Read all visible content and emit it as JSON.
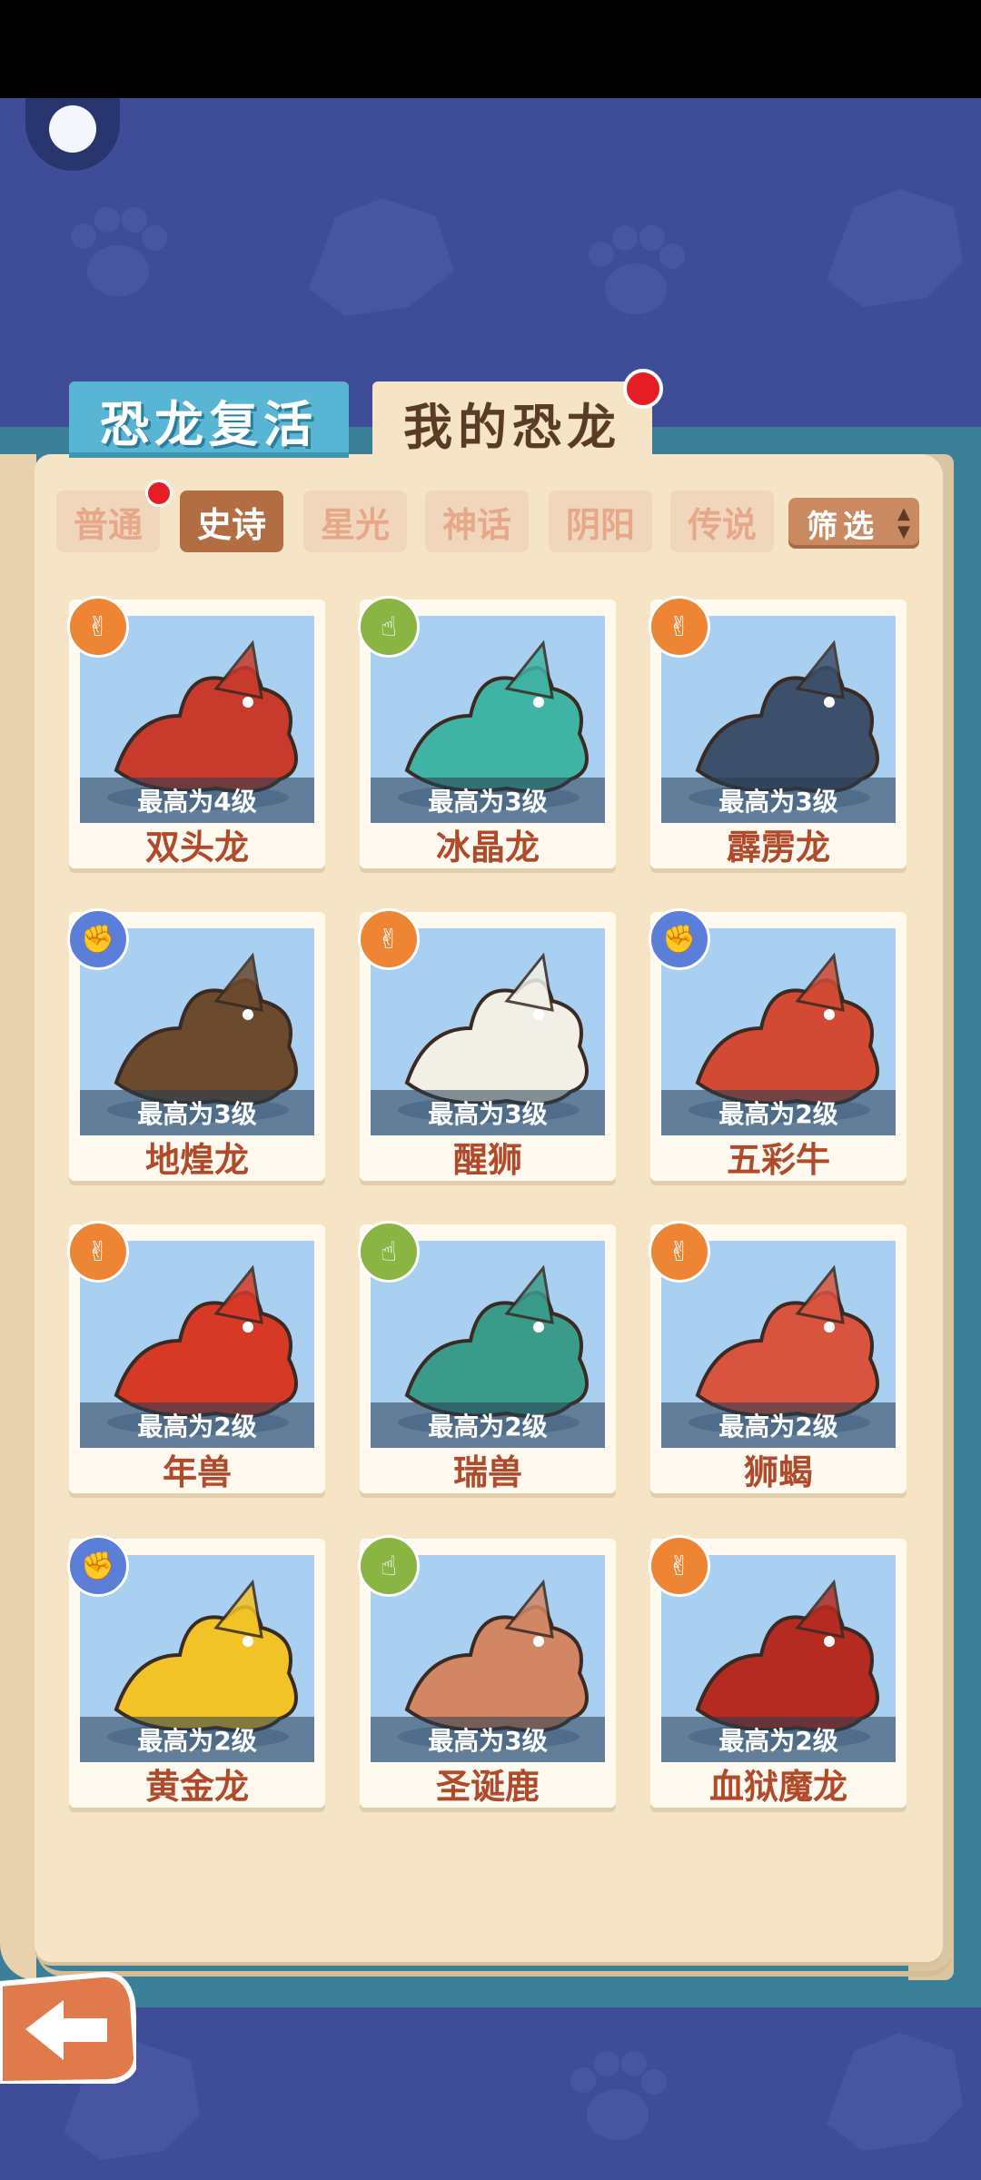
{
  "tabs": {
    "revive": "恐龙复活",
    "mine": "我的恐龙"
  },
  "rarities": [
    {
      "label": "普通",
      "active": false
    },
    {
      "label": "史诗",
      "active": true
    },
    {
      "label": "星光",
      "active": false
    },
    {
      "label": "神话",
      "active": false
    },
    {
      "label": "阴阳",
      "active": false
    },
    {
      "label": "传说",
      "active": false
    }
  ],
  "filter": {
    "label": "筛选"
  },
  "cards": [
    {
      "name": "双头龙",
      "level": "最高为4级",
      "badge": "scissors",
      "color": "#c83a2c"
    },
    {
      "name": "冰晶龙",
      "level": "最高为3级",
      "badge": "paper",
      "color": "#3fb4a4"
    },
    {
      "name": "霹雳龙",
      "level": "最高为3级",
      "badge": "scissors",
      "color": "#3c4f6b"
    },
    {
      "name": "地煌龙",
      "level": "最高为3级",
      "badge": "rock",
      "color": "#6b4a2e"
    },
    {
      "name": "醒狮",
      "level": "最高为3级",
      "badge": "scissors",
      "color": "#f2efe6"
    },
    {
      "name": "五彩牛",
      "level": "最高为2级",
      "badge": "rock",
      "color": "#d24a34"
    },
    {
      "name": "年兽",
      "level": "最高为2级",
      "badge": "scissors",
      "color": "#d63a26"
    },
    {
      "name": "瑞兽",
      "level": "最高为2级",
      "badge": "paper",
      "color": "#3a9b8a"
    },
    {
      "name": "狮蝎",
      "level": "最高为2级",
      "badge": "scissors",
      "color": "#d8543f"
    },
    {
      "name": "黄金龙",
      "level": "最高为2级",
      "badge": "rock",
      "color": "#f2c326"
    },
    {
      "name": "圣诞鹿",
      "level": "最高为3级",
      "badge": "paper",
      "color": "#d28664"
    },
    {
      "name": "血狱魔龙",
      "level": "最高为2级",
      "badge": "scissors",
      "color": "#b52b21"
    }
  ],
  "icons": {
    "scissors": "scissors-hand-icon",
    "rock": "fist-hand-icon",
    "paper": "pointing-hand-icon"
  }
}
